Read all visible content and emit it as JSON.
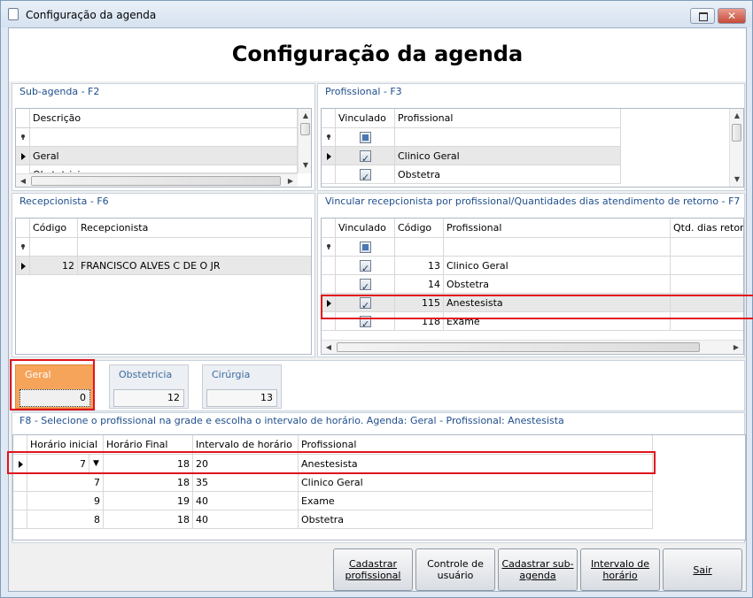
{
  "window": {
    "title": "Configuração da agenda"
  },
  "header": {
    "title": "Configuração da agenda"
  },
  "subagenda": {
    "panel_title": "Sub-agenda - F2",
    "col_descricao": "Descrição",
    "rows": [
      "Geral",
      "Obstetricia"
    ]
  },
  "profissional": {
    "panel_title": "Profissional - F3",
    "col_vinculado": "Vinculado",
    "col_profissional": "Profissional",
    "rows": [
      {
        "vinculado": true,
        "nome": "Clinico Geral"
      },
      {
        "vinculado": true,
        "nome": "Obstetra"
      }
    ]
  },
  "recepcionista": {
    "panel_title": "Recepcionista - F6",
    "col_codigo": "Código",
    "col_recepcionista": "Recepcionista",
    "rows": [
      {
        "codigo": "12",
        "nome": "FRANCISCO ALVES C DE O JR"
      }
    ]
  },
  "vincular": {
    "panel_title": "Vincular recepcionista por profissional/Quantidades dias atendimento de retorno - F7",
    "col_vinculado": "Vinculado",
    "col_codigo": "Código",
    "col_profissional": "Profissional",
    "col_qtd": "Qtd. dias retorno",
    "rows": [
      {
        "vinculado": true,
        "codigo": "13",
        "nome": "Clinico Geral"
      },
      {
        "vinculado": true,
        "codigo": "14",
        "nome": "Obstetra"
      },
      {
        "vinculado": true,
        "codigo": "115",
        "nome": "Anestesista"
      },
      {
        "vinculado": true,
        "codigo": "118",
        "nome": "Exame"
      }
    ]
  },
  "tabs": [
    {
      "label": "Geral",
      "value": "0"
    },
    {
      "label": "Obstetricia",
      "value": "12"
    },
    {
      "label": "Cirúrgia",
      "value": "13"
    }
  ],
  "horarios": {
    "panel_title": "F8 - Selecione o profissional na grade e escolha o intervalo de horário. Agenda: Geral - Profissional: Anestesista",
    "col_inicial": "Horário inicial",
    "col_final": "Horário Final",
    "col_intervalo": "Intervalo de horário",
    "col_profissional": "Profissional",
    "rows": [
      {
        "inicial": "7",
        "final": "18",
        "intervalo": "20",
        "profissional": "Anestesista"
      },
      {
        "inicial": "7",
        "final": "18",
        "intervalo": "35",
        "profissional": "Clinico Geral"
      },
      {
        "inicial": "9",
        "final": "19",
        "intervalo": "40",
        "profissional": "Exame"
      },
      {
        "inicial": "8",
        "final": "18",
        "intervalo": "40",
        "profissional": "Obstetra"
      }
    ]
  },
  "buttons": {
    "cadastrar_profissional": "Cadastrar profissional",
    "controle_usuario": "Controle de usuário",
    "cadastrar_subagenda": "Cadastrar sub-agenda",
    "intervalo_horario": "Intervalo de horário",
    "sair": "Sair"
  }
}
